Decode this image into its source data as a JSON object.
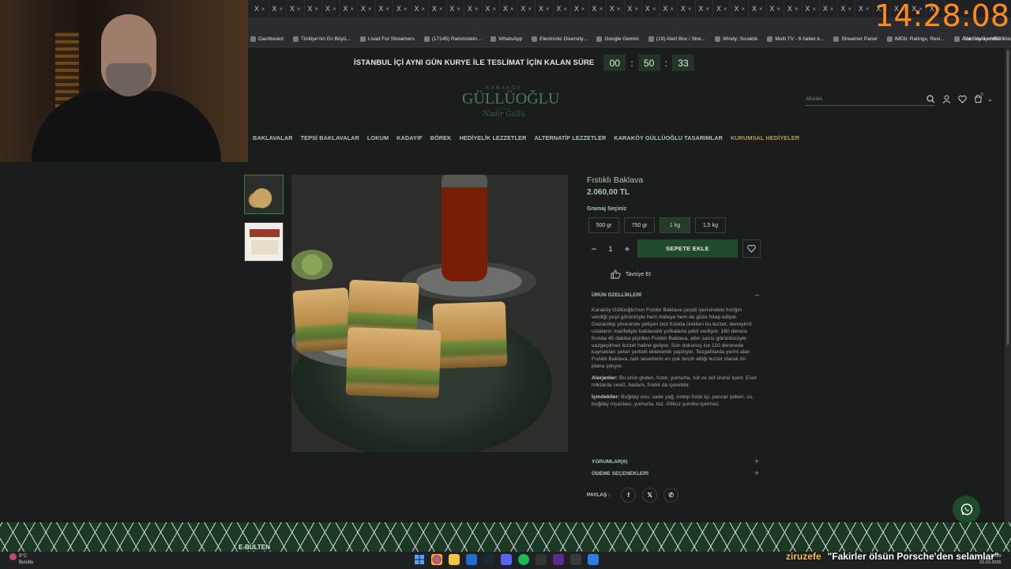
{
  "overlay": {
    "clock": "14:28:08",
    "chat_user": "ziruzefe",
    "chat_message": "\"Fakirler ölsün Porsche'den selamlar\""
  },
  "browser": {
    "tabs": [
      "X",
      "X",
      "X",
      "X",
      "X",
      "X",
      "X",
      "X",
      "X",
      "X",
      "X",
      "X",
      "X",
      "X",
      "X",
      "X",
      "X",
      "X",
      "X",
      "X",
      "X",
      "X",
      "X",
      "X",
      "X",
      "X",
      "X",
      "X",
      "X",
      "X",
      "X",
      "X",
      "X",
      "X",
      "X",
      "X",
      "X",
      "X",
      "X"
    ],
    "bookmarks": [
      {
        "label": "Dashboard",
        "icon": "dashboard-icon"
      },
      {
        "label": "Türkiye'nin En Büyü...",
        "icon": "bookmark-icon"
      },
      {
        "label": "Livad For Streamers",
        "icon": "bookmark-icon"
      },
      {
        "label": "(17145) Rammstein...",
        "icon": "youtube-icon"
      },
      {
        "label": "WhatsApp",
        "icon": "whatsapp-icon"
      },
      {
        "label": "Electronic Diversity...",
        "icon": "page-icon"
      },
      {
        "label": "Google Gemini",
        "icon": "gemini-icon"
      },
      {
        "label": "(19) Alert Box / Stre...",
        "icon": "bookmark-icon"
      },
      {
        "label": "Windy: Sıcaklık",
        "icon": "bookmark-icon"
      },
      {
        "label": "Multi TV - 6 haber k...",
        "icon": "bookmark-icon"
      },
      {
        "label": "Streamer Panel",
        "icon": "bookmark-icon"
      },
      {
        "label": "IMDb: Ratings, Revi...",
        "icon": "imdb-icon"
      },
      {
        "label": "Ana Sayfa • HBO Max",
        "icon": "bookmark-icon"
      }
    ],
    "all_bookmarks": "Tüm Yer İşaretleri"
  },
  "site": {
    "announcement": "İSTANBUL İÇİ AYNI GÜN KURYE İLE TESLİMAT İÇİN KALAN SÜRE",
    "countdown": [
      "00",
      "50",
      "33"
    ],
    "logo": {
      "top": "KARAKÖY",
      "main": "GÜLLÜOĞLU",
      "year": "1949",
      "signature": "Nadir Güllü"
    },
    "search_placeholder": "ARAMA",
    "cart_count": "0",
    "nav": [
      "BAKLAVALAR",
      "TEPSİ BAKLAVALAR",
      "LOKUM",
      "KADAYIF",
      "BÖREK",
      "HEDİYELİK LEZZETLER",
      "ALTERNATİF LEZZETLER",
      "KARAKÖY GÜLLÜOĞLU TASARIMLAR",
      "KURUMSAL HEDİYELER"
    ]
  },
  "product": {
    "title": "Fıstıklı Baklava",
    "price": "2.060,00 TL",
    "weight_label": "Gramaj Seçiniz",
    "weights": [
      "500 gr",
      "750 gr",
      "1 kg",
      "1,5 kg"
    ],
    "selected_weight": "1 kg",
    "quantity": "1",
    "add_to_cart": "SEPETE EKLE",
    "recommend": "Tavsiye Et",
    "features_title": "ÜRÜN ÖZELLİKLERİ",
    "description": "Karaköy Güllüoğlu'nun Fıstıklı Baklava çeşidi içerisindeki fıstığın verdiği yeşil görüntüyle hem mideye hem de göze hitap ediyor. Gaziantep yöresinde yetişen boz fıstıkla üretilen bu lezzet, deneyimli ustaların marifetiyle baklavalık yufkalarla şekil veriliyor. 160 derece fırında 45 dakika pişirilen Fıstıklı Baklava, altın sarısı görüntüsüyle vazgeçilmez lezzet haline geliyor. Son dokunuş ise 110 derecede kaynatılan şeker şerbeti eklenerek yapılıyor. Tezgahlarda yerini alan Fıstıklı Baklava, tatlı severlerin en çok tercih ettiği lezzet olarak ön plana çıkıyor.",
    "allergens_label": "Alerjenler:",
    "allergens": "Bu ürün gluten, fıstık, yumurta, süt ve süt ürünü içerir. Eser miktarda ceviz, badem, fındık da içerebilir.",
    "ingredients_label": "İçindekiler:",
    "ingredients": "Buğday unu, sade yağ, Antep fıstık içi, pancar şekeri, su, buğday nişastası, yumurta, tuz. Glikoz şurubu içermez.",
    "reviews_title": "YORUMLAR(6)",
    "payment_title": "ÖDEME SEÇENEKLERİ",
    "share_label": "PAYLAŞ :"
  },
  "footer": {
    "newsletter": "E-BÜLTEN"
  },
  "taskbar": {
    "weather_temp": "9°C",
    "weather_desc": "Bulutlu",
    "time": "18:09",
    "date": "23.03.2026"
  },
  "colors": {
    "accent_green": "#1f4b2c",
    "clock_orange": "#ff8a1e",
    "text_green": "#a9c8b0"
  }
}
